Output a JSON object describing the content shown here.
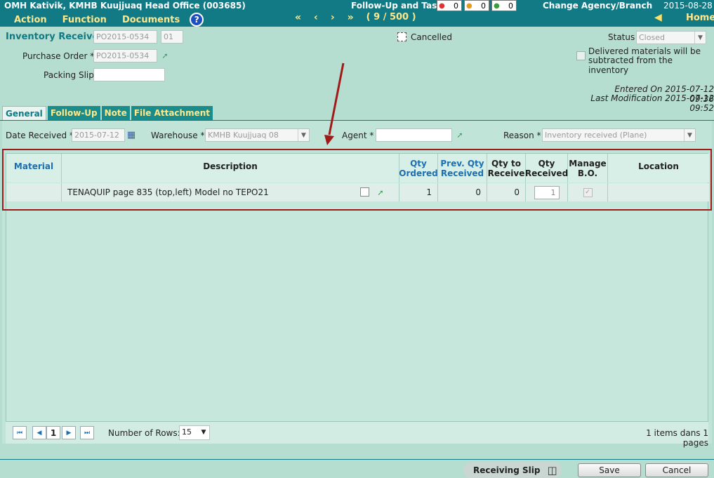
{
  "header": {
    "org": "OMH Kativik, KMHB Kuujjuaq Head Office (003685)",
    "menu": [
      "Action",
      "Function",
      "Documents"
    ],
    "help": "?",
    "nav": {
      "first": "«",
      "prev": "‹",
      "next": "›",
      "last": "»",
      "count": "( 9 / 500 )"
    },
    "follow_label": "Follow-Up and Task",
    "badges": [
      "0",
      "0",
      "0"
    ],
    "change_label": "Change Agency/Branch",
    "date": "2015-08-28",
    "home": "Home"
  },
  "form": {
    "inventory_received_label": "Inventory Received",
    "inventory_received_value": "PO2015-0534",
    "inventory_received_suffix": "01",
    "purchase_order_label": "Purchase Order *",
    "purchase_order_value": "PO2015-0534",
    "packing_slip_label": "Packing Slip",
    "packing_slip_value": "",
    "cancelled_label": "Cancelled",
    "status_label": "Status",
    "status_value": "Closed",
    "delivered_note_line1": "Delivered materials will be",
    "delivered_note_line2": "subtracted from the inventory",
    "entered_on": "Entered On 2015-07-12 09:36",
    "last_mod": "Last Modification 2015-07-12 09:52"
  },
  "tabs": [
    "General",
    "Follow-Up",
    "Note",
    "File Attachment"
  ],
  "filters": {
    "date_received_label": "Date Received *",
    "date_received_value": "2015-07-12",
    "warehouse_label": "Warehouse *",
    "warehouse_value": "KMHB Kuujjuaq 08",
    "agent_label": "Agent *",
    "agent_value": "",
    "reason_label": "Reason *",
    "reason_value": "Inventory received (Plane)"
  },
  "grid": {
    "headers": {
      "material": "Material",
      "description": "Description",
      "qty_ordered_1": "Qty",
      "qty_ordered_2": "Ordered",
      "prev_qty_1": "Prev. Qty",
      "prev_qty_2": "Received",
      "qty_to_1": "Qty to",
      "qty_to_2": "Receive",
      "qty_rec_1": "Qty",
      "qty_rec_2": "Received",
      "manage_1": "Manage",
      "manage_2": "B.O.",
      "location": "Location"
    },
    "row": {
      "material": "",
      "description": "TENAQUIP page 835 (top,left) Model no TEPO21",
      "qty_ordered": "1",
      "prev_qty": "0",
      "qty_to_receive": "0",
      "qty_received": "1",
      "location": ""
    }
  },
  "pager": {
    "current": "1",
    "rows_label": "Number of Rows:",
    "rows_value": "15",
    "summary": "1 items dans 1 pages"
  },
  "footer": {
    "receiving_slip": "Receiving Slip",
    "save": "Save",
    "cancel": "Cancel"
  }
}
